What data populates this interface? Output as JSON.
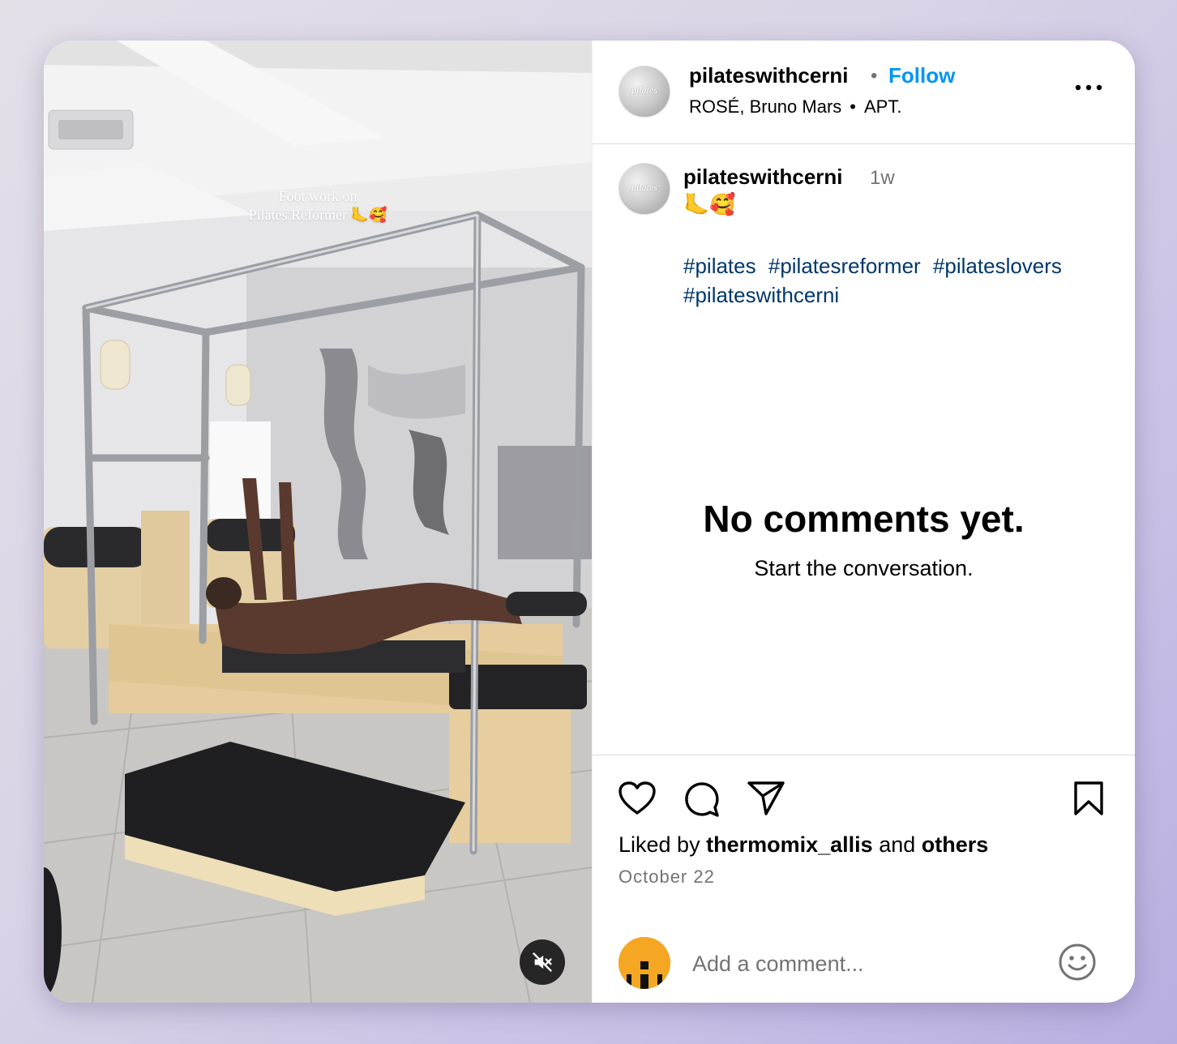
{
  "post": {
    "media": {
      "overlay_line1": "Foot work on",
      "overlay_line2": "Pilates Reformer 🦶🥰",
      "mute_icon": "speaker-muted-icon"
    },
    "header": {
      "username": "pilateswithcerni",
      "dot": "•",
      "follow_label": "Follow",
      "audio_artist": "ROSÉ, Bruno Mars",
      "audio_sep": "•",
      "audio_title": "APT.",
      "more_icon": "more-options-icon",
      "avatar_logo": "pilates"
    },
    "caption": {
      "username": "pilateswithcerni",
      "time": "1w",
      "emoji": "🦶🥰",
      "hashtags": [
        "#pilates",
        "#pilatesreformer",
        "#pilateslovers",
        "#pilateswithcerni"
      ]
    },
    "comments": {
      "empty_title": "No comments yet.",
      "empty_subtitle": "Start the conversation."
    },
    "actions": {
      "icons": [
        "heart-icon",
        "comment-icon",
        "share-icon",
        "bookmark-icon"
      ]
    },
    "likes": {
      "prefix": "Liked by",
      "user": "thermomix_allis",
      "middle": "and",
      "others": "others"
    },
    "date": "October 22",
    "add_comment": {
      "placeholder": "Add a comment...",
      "emoji_icon": "smiley-icon"
    }
  },
  "colors": {
    "follow_blue": "#0095f6",
    "hashtag_blue": "#00376b",
    "secondary_text": "#737373",
    "divider": "#dbdbdb",
    "user_avatar": "#f5a623"
  }
}
